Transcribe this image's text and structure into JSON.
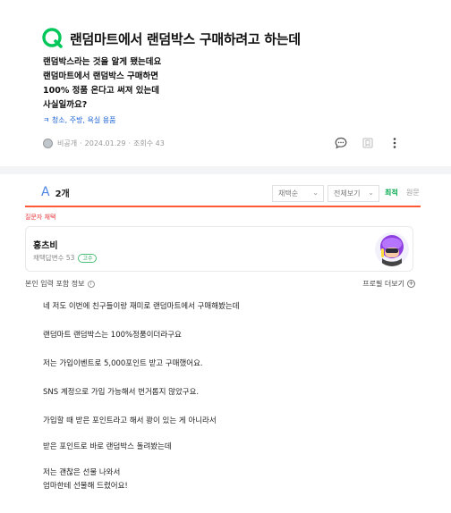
{
  "question": {
    "title": "랜덤마트에서 랜덤박스 구매하려고 하는데",
    "body": [
      "랜덤박스라는 것을 알게 됐는데요",
      "랜덤마트에서 랜덤박스 구매하면",
      "100% 정품 온다고 써져 있는데",
      "사실일까요?"
    ],
    "tags": "ㅋ 청소, 주방, 욕실 용품",
    "author": "비공개",
    "date": "2024.01.29",
    "views": "조회수 43",
    "icons": [
      "comment-icon",
      "bookmark-icon",
      "more-icon"
    ]
  },
  "answers_header": {
    "mark": "A",
    "count": "2개",
    "select_1": "채택순",
    "select_2": "전체보기",
    "sort_new": "최적",
    "sort_old": "원문"
  },
  "accepted_label": "질문자 채택",
  "answerer": {
    "name": "홍츠비",
    "stat": "채택답변수 53",
    "level": "고수"
  },
  "intro": {
    "left": "본인 입력 포함 정보",
    "right": "프로필 더보기"
  },
  "answer": {
    "paragraphs": [
      "네 저도 이번에 친구들이랑 재미로 랜덤마트에서 구매해봤는데",
      "랜덤마트 랜덤박스는 100%정품이더라구요",
      "저는 가입이벤트로 5,000포인트 받고 구매했어요.",
      "SNS 계정으로 가입 가능해서 번거롭지 않았구요.",
      "가입할 때 받은 포인트라고 해서 꽝이 있는 게 아니라서",
      "받은 포인트로 바로 랜덤박스 돌려봤는데",
      "저는 괜찮은 선물 나와서",
      "엄마한테 선물해 드렸어요!"
    ]
  },
  "colors": {
    "q_mark": "#03c75a",
    "a_mark": "#4f86e6",
    "accent_line": "#ff5a36",
    "accepted": "#e8383d",
    "tag_blue": "#1c63d6",
    "sort_active": "#03a94d"
  }
}
